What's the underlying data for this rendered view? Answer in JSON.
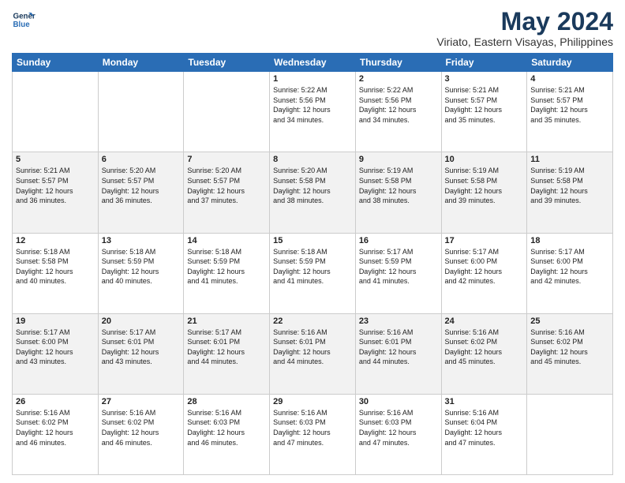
{
  "header": {
    "logo_line1": "General",
    "logo_line2": "Blue",
    "title": "May 2024",
    "subtitle": "Viriato, Eastern Visayas, Philippines"
  },
  "days_of_week": [
    "Sunday",
    "Monday",
    "Tuesday",
    "Wednesday",
    "Thursday",
    "Friday",
    "Saturday"
  ],
  "weeks": [
    {
      "shaded": false,
      "days": [
        {
          "num": "",
          "info": ""
        },
        {
          "num": "",
          "info": ""
        },
        {
          "num": "",
          "info": ""
        },
        {
          "num": "1",
          "info": "Sunrise: 5:22 AM\nSunset: 5:56 PM\nDaylight: 12 hours\nand 34 minutes."
        },
        {
          "num": "2",
          "info": "Sunrise: 5:22 AM\nSunset: 5:56 PM\nDaylight: 12 hours\nand 34 minutes."
        },
        {
          "num": "3",
          "info": "Sunrise: 5:21 AM\nSunset: 5:57 PM\nDaylight: 12 hours\nand 35 minutes."
        },
        {
          "num": "4",
          "info": "Sunrise: 5:21 AM\nSunset: 5:57 PM\nDaylight: 12 hours\nand 35 minutes."
        }
      ]
    },
    {
      "shaded": true,
      "days": [
        {
          "num": "5",
          "info": "Sunrise: 5:21 AM\nSunset: 5:57 PM\nDaylight: 12 hours\nand 36 minutes."
        },
        {
          "num": "6",
          "info": "Sunrise: 5:20 AM\nSunset: 5:57 PM\nDaylight: 12 hours\nand 36 minutes."
        },
        {
          "num": "7",
          "info": "Sunrise: 5:20 AM\nSunset: 5:57 PM\nDaylight: 12 hours\nand 37 minutes."
        },
        {
          "num": "8",
          "info": "Sunrise: 5:20 AM\nSunset: 5:58 PM\nDaylight: 12 hours\nand 38 minutes."
        },
        {
          "num": "9",
          "info": "Sunrise: 5:19 AM\nSunset: 5:58 PM\nDaylight: 12 hours\nand 38 minutes."
        },
        {
          "num": "10",
          "info": "Sunrise: 5:19 AM\nSunset: 5:58 PM\nDaylight: 12 hours\nand 39 minutes."
        },
        {
          "num": "11",
          "info": "Sunrise: 5:19 AM\nSunset: 5:58 PM\nDaylight: 12 hours\nand 39 minutes."
        }
      ]
    },
    {
      "shaded": false,
      "days": [
        {
          "num": "12",
          "info": "Sunrise: 5:18 AM\nSunset: 5:58 PM\nDaylight: 12 hours\nand 40 minutes."
        },
        {
          "num": "13",
          "info": "Sunrise: 5:18 AM\nSunset: 5:59 PM\nDaylight: 12 hours\nand 40 minutes."
        },
        {
          "num": "14",
          "info": "Sunrise: 5:18 AM\nSunset: 5:59 PM\nDaylight: 12 hours\nand 41 minutes."
        },
        {
          "num": "15",
          "info": "Sunrise: 5:18 AM\nSunset: 5:59 PM\nDaylight: 12 hours\nand 41 minutes."
        },
        {
          "num": "16",
          "info": "Sunrise: 5:17 AM\nSunset: 5:59 PM\nDaylight: 12 hours\nand 41 minutes."
        },
        {
          "num": "17",
          "info": "Sunrise: 5:17 AM\nSunset: 6:00 PM\nDaylight: 12 hours\nand 42 minutes."
        },
        {
          "num": "18",
          "info": "Sunrise: 5:17 AM\nSunset: 6:00 PM\nDaylight: 12 hours\nand 42 minutes."
        }
      ]
    },
    {
      "shaded": true,
      "days": [
        {
          "num": "19",
          "info": "Sunrise: 5:17 AM\nSunset: 6:00 PM\nDaylight: 12 hours\nand 43 minutes."
        },
        {
          "num": "20",
          "info": "Sunrise: 5:17 AM\nSunset: 6:01 PM\nDaylight: 12 hours\nand 43 minutes."
        },
        {
          "num": "21",
          "info": "Sunrise: 5:17 AM\nSunset: 6:01 PM\nDaylight: 12 hours\nand 44 minutes."
        },
        {
          "num": "22",
          "info": "Sunrise: 5:16 AM\nSunset: 6:01 PM\nDaylight: 12 hours\nand 44 minutes."
        },
        {
          "num": "23",
          "info": "Sunrise: 5:16 AM\nSunset: 6:01 PM\nDaylight: 12 hours\nand 44 minutes."
        },
        {
          "num": "24",
          "info": "Sunrise: 5:16 AM\nSunset: 6:02 PM\nDaylight: 12 hours\nand 45 minutes."
        },
        {
          "num": "25",
          "info": "Sunrise: 5:16 AM\nSunset: 6:02 PM\nDaylight: 12 hours\nand 45 minutes."
        }
      ]
    },
    {
      "shaded": false,
      "days": [
        {
          "num": "26",
          "info": "Sunrise: 5:16 AM\nSunset: 6:02 PM\nDaylight: 12 hours\nand 46 minutes."
        },
        {
          "num": "27",
          "info": "Sunrise: 5:16 AM\nSunset: 6:02 PM\nDaylight: 12 hours\nand 46 minutes."
        },
        {
          "num": "28",
          "info": "Sunrise: 5:16 AM\nSunset: 6:03 PM\nDaylight: 12 hours\nand 46 minutes."
        },
        {
          "num": "29",
          "info": "Sunrise: 5:16 AM\nSunset: 6:03 PM\nDaylight: 12 hours\nand 47 minutes."
        },
        {
          "num": "30",
          "info": "Sunrise: 5:16 AM\nSunset: 6:03 PM\nDaylight: 12 hours\nand 47 minutes."
        },
        {
          "num": "31",
          "info": "Sunrise: 5:16 AM\nSunset: 6:04 PM\nDaylight: 12 hours\nand 47 minutes."
        },
        {
          "num": "",
          "info": ""
        }
      ]
    }
  ]
}
